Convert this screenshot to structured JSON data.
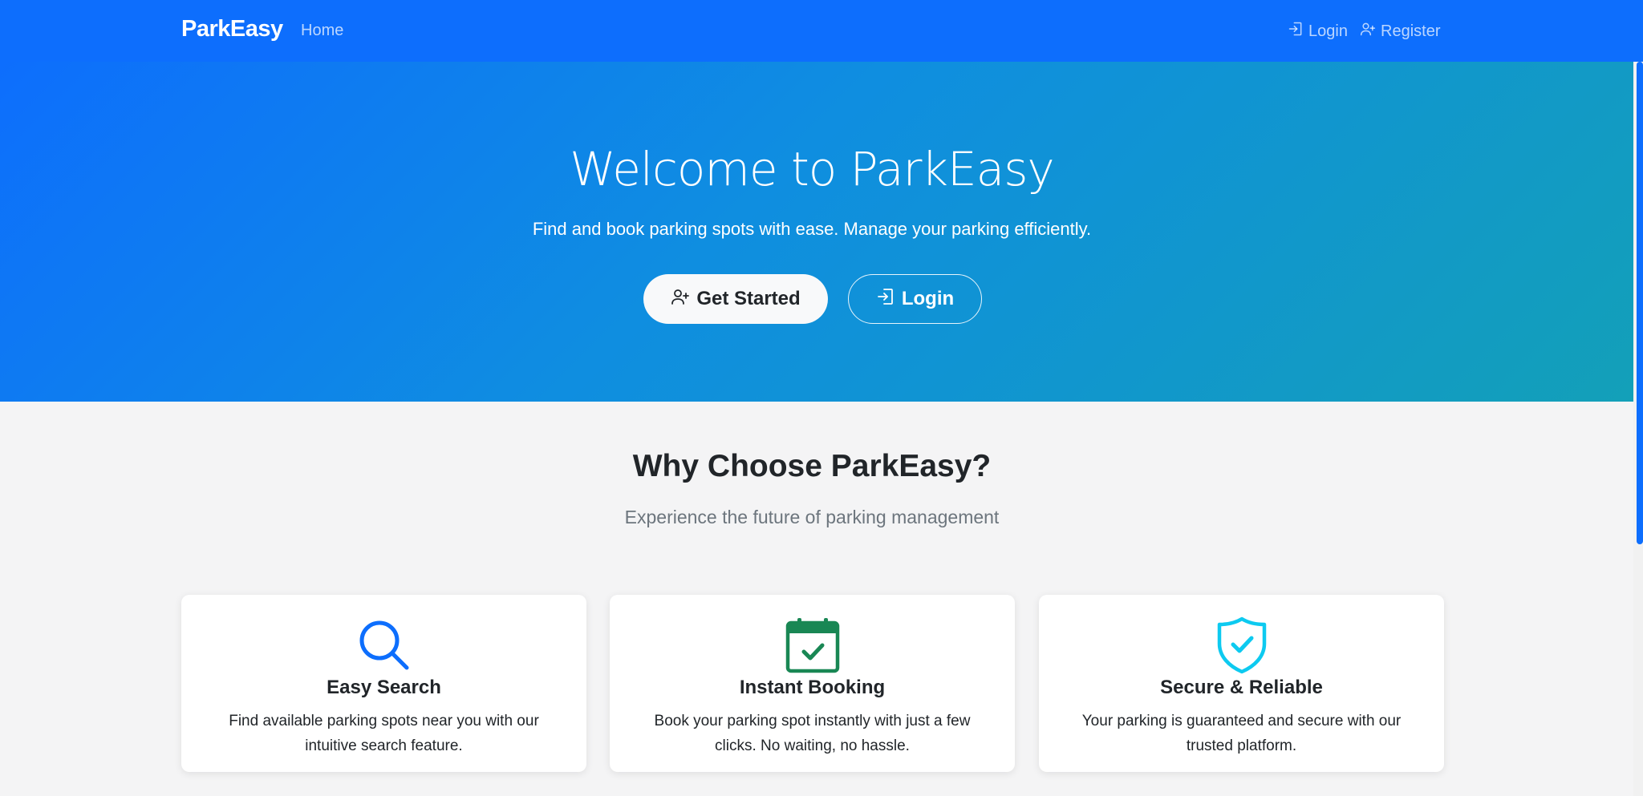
{
  "nav": {
    "brand": "ParkEasy",
    "home": "Home",
    "login": "Login",
    "register": "Register"
  },
  "hero": {
    "title": "Welcome to ParkEasy",
    "subtitle": "Find and book parking spots with ease. Manage your parking efficiently.",
    "primary_button": "Get Started",
    "secondary_button": "Login"
  },
  "features": {
    "title": "Why Choose ParkEasy?",
    "subtitle": "Experience the future of parking management",
    "cards": [
      {
        "icon": "search-icon",
        "title": "Easy Search",
        "text": "Find available parking spots near you with our intuitive search feature."
      },
      {
        "icon": "calendar-check-icon",
        "title": "Instant Booking",
        "text": "Book your parking spot instantly with just a few clicks. No waiting, no hassle."
      },
      {
        "icon": "shield-check-icon",
        "title": "Secure & Reliable",
        "text": "Your parking is guaranteed and secure with our trusted platform."
      }
    ]
  },
  "colors": {
    "primary": "#0d6efd",
    "success": "#198754",
    "info": "#0dcaf0",
    "background": "#f4f4f5"
  }
}
